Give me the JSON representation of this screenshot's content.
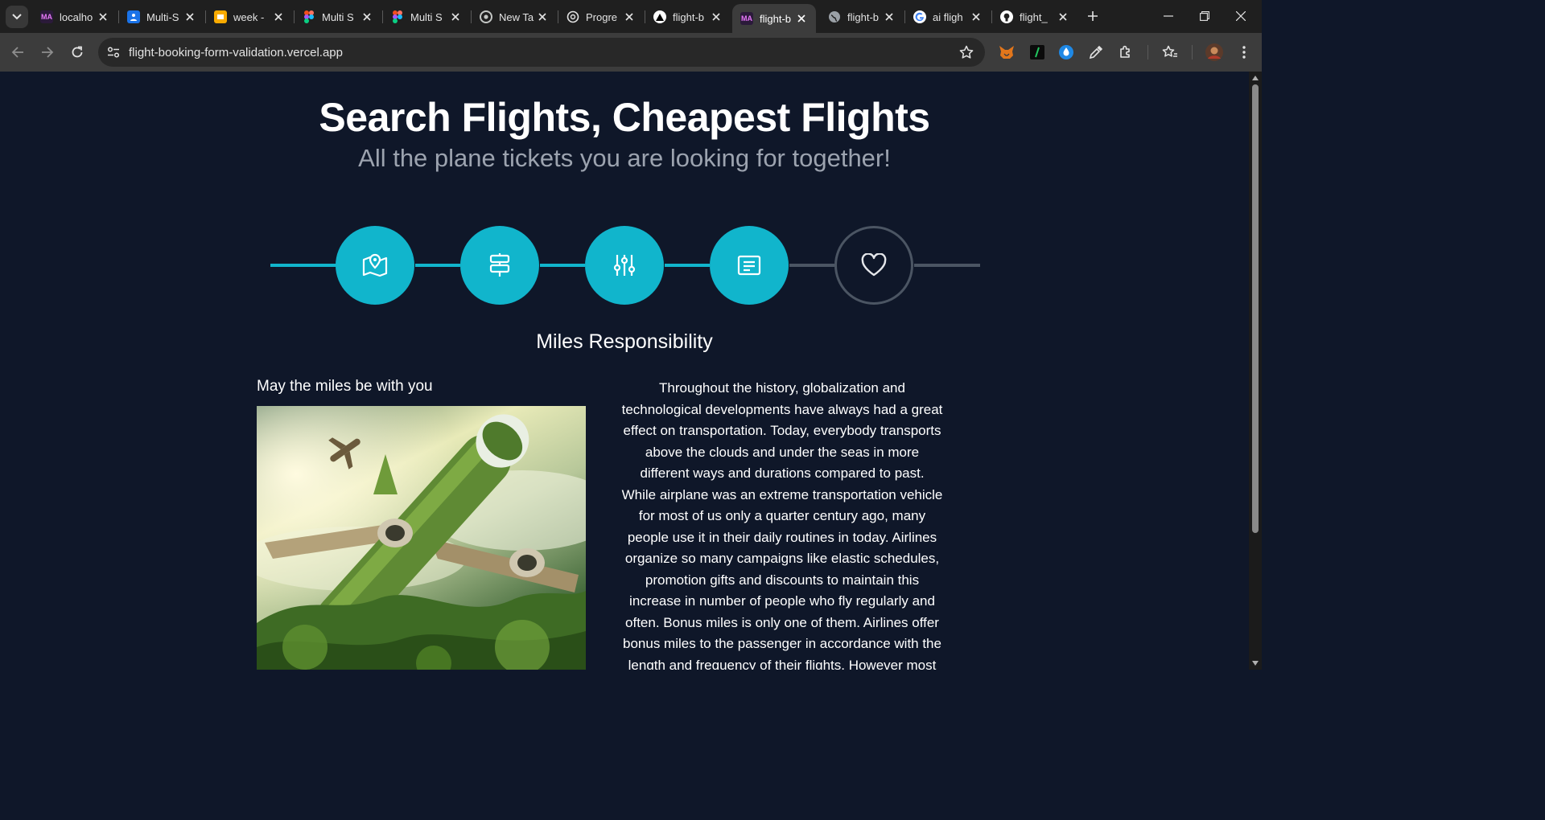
{
  "browser": {
    "tabs": [
      {
        "favicon": "MA",
        "favicon_color": "#2b1a3a",
        "favicon_text_color": "#e879f9",
        "label": "localho",
        "active": false
      },
      {
        "favicon": "person-icon",
        "favicon_color": "#1a73e8",
        "label": "Multi-S",
        "active": false
      },
      {
        "favicon": "slides-icon",
        "favicon_color": "#f9ab00",
        "label": "week -",
        "active": false
      },
      {
        "favicon": "figma-icon",
        "favicon_color": "#a259ff",
        "label": "Multi S",
        "active": false
      },
      {
        "favicon": "figma-icon",
        "favicon_color": "#a259ff",
        "label": "Multi S",
        "active": false
      },
      {
        "favicon": "chrome-icon",
        "favicon_color": "#9aa0a6",
        "label": "New Ta",
        "active": false
      },
      {
        "favicon": "openai-icon",
        "favicon_color": "#e3e3e3",
        "label": "Progre",
        "active": false
      },
      {
        "favicon": "vercel-icon",
        "favicon_color": "#ffffff",
        "label": "flight-b",
        "active": false
      },
      {
        "favicon": "MA",
        "favicon_color": "#2b1a3a",
        "favicon_text_color": "#e879f9",
        "label": "flight-b",
        "active": true
      },
      {
        "favicon": "globe-icon",
        "favicon_color": "#9aa0a6",
        "label": "flight-b",
        "active": false
      },
      {
        "favicon": "google-icon",
        "favicon_color": "#ffffff",
        "label": "ai fligh",
        "active": false
      },
      {
        "favicon": "github-icon",
        "favicon_color": "#ffffff",
        "label": "flight_",
        "active": false
      }
    ],
    "url": "flight-booking-form-validation.vercel.app"
  },
  "hero": {
    "title": "Search Flights, Cheapest Flights",
    "subtitle": "All the plane tickets you are looking for together!"
  },
  "stepper": {
    "accent": "#11b5cc",
    "inactive": "#4b5563",
    "steps": [
      {
        "icon": "map-pin-icon",
        "completed": true
      },
      {
        "icon": "signpost-icon",
        "completed": true
      },
      {
        "icon": "sliders-icon",
        "completed": true
      },
      {
        "icon": "message-icon",
        "completed": true
      },
      {
        "icon": "heart-icon",
        "completed": false
      }
    ]
  },
  "section": {
    "title": "Miles Responsibility",
    "left_heading": "May the miles be with you",
    "image_alt": "green-airplane-photo",
    "paragraph": "Throughout the history, globalization and technological developments have always had a great effect on transportation. Today, everybody transports above the clouds and under the seas in more different ways and durations compared to past. While airplane was an extreme transportation vehicle for most of us only a quarter century ago, many people use it in their daily routines in today. Airlines organize so many campaigns like elastic schedules, promotion gifts and discounts to maintain this increase in number of people who fly regularly and often. Bonus miles is only one of them. Airlines offer bonus miles to the passenger in accordance with the length and frequency of their flights. However most of these"
  }
}
